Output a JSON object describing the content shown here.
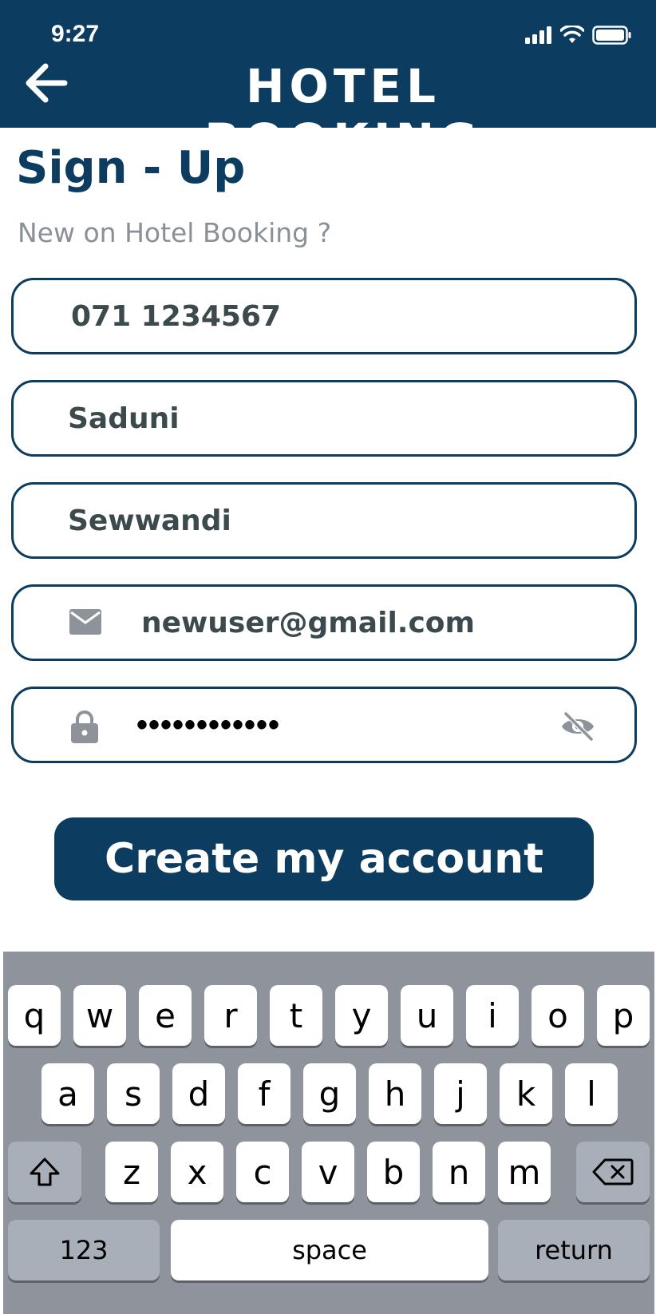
{
  "status_bar": {
    "time": "9:27"
  },
  "header": {
    "title": "HOTEL BOOKING"
  },
  "page": {
    "title": "Sign - Up",
    "subtitle": "New on Hotel Booking ?"
  },
  "form": {
    "phone_value": "071 1234567",
    "first_name_value": "Saduni",
    "last_name_value": "Sewwandi",
    "email_value": "newuser@gmail.com",
    "password_masked": "••••••••••••"
  },
  "button": {
    "create_account": "Create my account"
  },
  "keyboard": {
    "row1": [
      "q",
      "w",
      "e",
      "r",
      "t",
      "y",
      "u",
      "i",
      "o",
      "p"
    ],
    "row2": [
      "a",
      "s",
      "d",
      "f",
      "g",
      "h",
      "j",
      "k",
      "l"
    ],
    "row3": [
      "z",
      "x",
      "c",
      "v",
      "b",
      "n",
      "m"
    ],
    "numbers_label": "123",
    "space_label": "space",
    "return_label": "return"
  },
  "colors": {
    "brand": "#0c3c5f",
    "keyboard_bg": "#8e939c",
    "muted_text": "#8a9097"
  }
}
